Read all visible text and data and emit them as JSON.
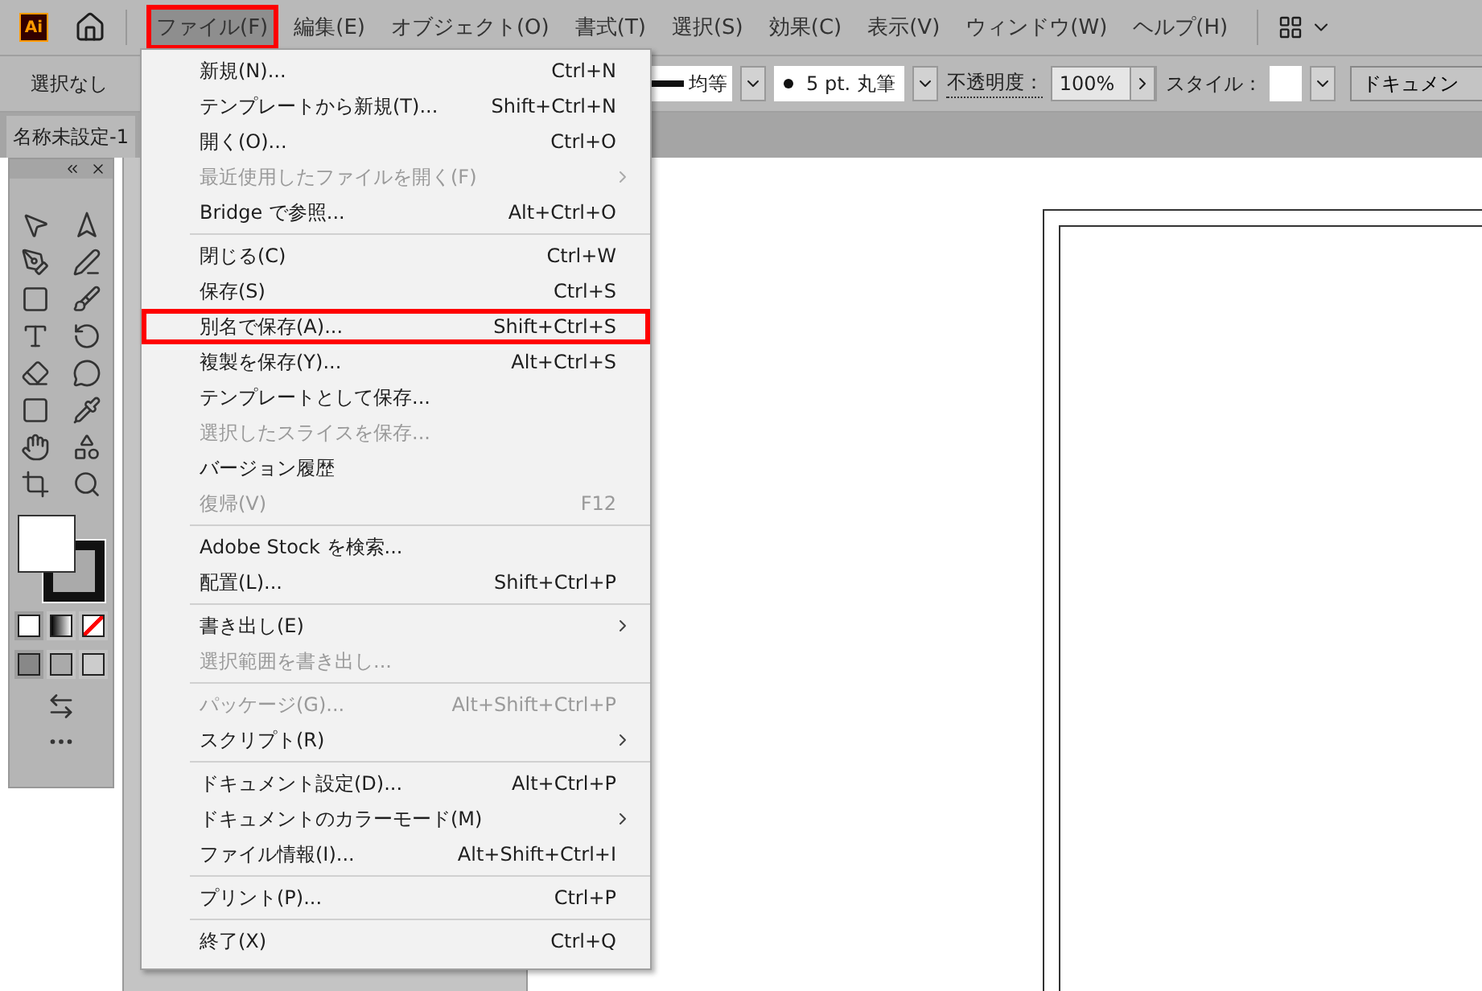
{
  "app": {
    "logo": "Ai"
  },
  "menubar": [
    {
      "label": "ファイル(F)",
      "selected": true,
      "annotated": true
    },
    {
      "label": "編集(E)",
      "selected": false,
      "annotated": false
    },
    {
      "label": "オブジェクト(O)",
      "selected": false,
      "annotated": false
    },
    {
      "label": "書式(T)",
      "selected": false,
      "annotated": false
    },
    {
      "label": "選択(S)",
      "selected": false,
      "annotated": false
    },
    {
      "label": "効果(C)",
      "selected": false,
      "annotated": false
    },
    {
      "label": "表示(V)",
      "selected": false,
      "annotated": false
    },
    {
      "label": "ウィンドウ(W)",
      "selected": false,
      "annotated": false
    },
    {
      "label": "ヘルプ(H)",
      "selected": false,
      "annotated": false
    }
  ],
  "control_bar": {
    "selection": "選択なし",
    "stroke_profile": "均等",
    "brush": "5 pt. 丸筆",
    "opacity_label": "不透明度：",
    "opacity": "100%",
    "style_label": "スタイル：",
    "document_button": "ドキュメン"
  },
  "document_tab": {
    "title": "名称未設定-1"
  },
  "file_menu": {
    "groups": [
      [
        {
          "label": "新規(N)...",
          "shortcut": "Ctrl+N",
          "disabled": false,
          "submenu": false,
          "annotated": false
        },
        {
          "label": "テンプレートから新規(T)...",
          "shortcut": "Shift+Ctrl+N",
          "disabled": false,
          "submenu": false,
          "annotated": false
        },
        {
          "label": "開く(O)...",
          "shortcut": "Ctrl+O",
          "disabled": false,
          "submenu": false,
          "annotated": false
        },
        {
          "label": "最近使用したファイルを開く(F)",
          "disabled": true,
          "submenu": true,
          "annotated": false
        },
        {
          "label": "Bridge で参照...",
          "shortcut": "Alt+Ctrl+O",
          "disabled": false,
          "submenu": false,
          "annotated": false
        }
      ],
      [
        {
          "label": "閉じる(C)",
          "shortcut": "Ctrl+W",
          "disabled": false,
          "submenu": false,
          "annotated": false
        },
        {
          "label": "保存(S)",
          "shortcut": "Ctrl+S",
          "disabled": false,
          "submenu": false,
          "annotated": false
        },
        {
          "label": "別名で保存(A)...",
          "shortcut": "Shift+Ctrl+S",
          "disabled": false,
          "submenu": false,
          "annotated": true
        },
        {
          "label": "複製を保存(Y)...",
          "shortcut": "Alt+Ctrl+S",
          "disabled": false,
          "submenu": false,
          "annotated": false
        },
        {
          "label": "テンプレートとして保存...",
          "disabled": false,
          "submenu": false,
          "annotated": false
        },
        {
          "label": "選択したスライスを保存...",
          "disabled": true,
          "submenu": false,
          "annotated": false
        },
        {
          "label": "バージョン履歴",
          "disabled": false,
          "submenu": false,
          "annotated": false
        },
        {
          "label": "復帰(V)",
          "shortcut": "F12",
          "disabled": true,
          "submenu": false,
          "annotated": false
        }
      ],
      [
        {
          "label": "Adobe Stock を検索...",
          "disabled": false,
          "submenu": false,
          "annotated": false
        },
        {
          "label": "配置(L)...",
          "shortcut": "Shift+Ctrl+P",
          "disabled": false,
          "submenu": false,
          "annotated": false
        }
      ],
      [
        {
          "label": "書き出し(E)",
          "disabled": false,
          "submenu": true,
          "annotated": false
        },
        {
          "label": "選択範囲を書き出し...",
          "disabled": true,
          "submenu": false,
          "annotated": false
        }
      ],
      [
        {
          "label": "パッケージ(G)...",
          "shortcut": "Alt+Shift+Ctrl+P",
          "disabled": true,
          "submenu": false,
          "annotated": false
        },
        {
          "label": "スクリプト(R)",
          "disabled": false,
          "submenu": true,
          "annotated": false
        }
      ],
      [
        {
          "label": "ドキュメント設定(D)...",
          "shortcut": "Alt+Ctrl+P",
          "disabled": false,
          "submenu": false,
          "annotated": false
        },
        {
          "label": "ドキュメントのカラーモード(M)",
          "disabled": false,
          "submenu": true,
          "annotated": false
        },
        {
          "label": "ファイル情報(I)...",
          "shortcut": "Alt+Shift+Ctrl+I",
          "disabled": false,
          "submenu": false,
          "annotated": false
        }
      ],
      [
        {
          "label": "プリント(P)...",
          "shortcut": "Ctrl+P",
          "disabled": false,
          "submenu": false,
          "annotated": false
        }
      ],
      [
        {
          "label": "終了(X)",
          "shortcut": "Ctrl+Q",
          "disabled": false,
          "submenu": false,
          "annotated": false
        }
      ]
    ]
  }
}
